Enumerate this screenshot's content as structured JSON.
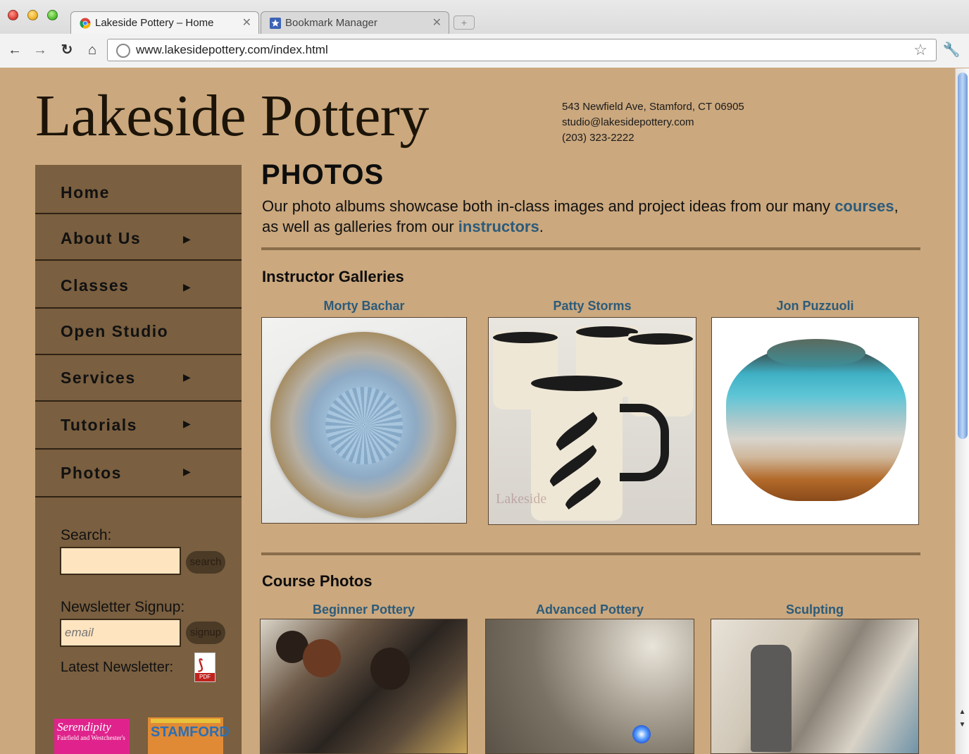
{
  "browser": {
    "tabs": [
      {
        "title": "Lakeside Pottery – Home",
        "active": true,
        "favicon": "chrome-favicon"
      },
      {
        "title": "Bookmark Manager",
        "active": false,
        "favicon": "bookmark-star-icon"
      }
    ],
    "url": "www.lakesidepottery.com/index.html"
  },
  "site": {
    "logo": "Lakeside Pottery",
    "contact": {
      "address": "543 Newfield Ave, Stamford, CT 06905",
      "email": "studio@lakesidepottery.com",
      "phone": "(203) 323-2222"
    }
  },
  "nav": [
    {
      "label": "Home",
      "has_submenu": false
    },
    {
      "label": "About Us",
      "has_submenu": true
    },
    {
      "label": "Classes",
      "has_submenu": true
    },
    {
      "label": "Open Studio",
      "has_submenu": false
    },
    {
      "label": "Services",
      "has_submenu": true
    },
    {
      "label": "Tutorials",
      "has_submenu": true
    },
    {
      "label": "Photos",
      "has_submenu": true
    }
  ],
  "sidebar": {
    "search_label": "Search:",
    "search_value": "",
    "search_button": "search",
    "newsletter_label": "Newsletter Signup:",
    "newsletter_placeholder": "email",
    "newsletter_button": "signup",
    "latest_newsletter_label": "Latest Newsletter:",
    "pdf_tag": "PDF",
    "badge1_text": "Serendipity",
    "badge1_sub": "Fairfield and Westchester's",
    "badge2_text": "STAMFORD"
  },
  "main": {
    "title": "PHOTOS",
    "intro_before": "Our photo albums showcase both in-class images and project ideas from our many ",
    "intro_link1": "courses",
    "intro_middle": ", as well as galleries from our ",
    "intro_link2": "instructors",
    "intro_after": ".",
    "instructor_section": "Instructor Galleries",
    "instructors": [
      "Morty Bachar",
      "Patty Storms",
      "Jon Puzzuoli"
    ],
    "course_section": "Course Photos",
    "courses": [
      "Beginner Pottery",
      "Advanced Pottery",
      "Sculpting"
    ],
    "watermark": "Lakeside"
  },
  "colors": {
    "page_bg": "#cba87e",
    "sidebar_bg": "#7a5f40",
    "link": "#2c5b7a"
  }
}
